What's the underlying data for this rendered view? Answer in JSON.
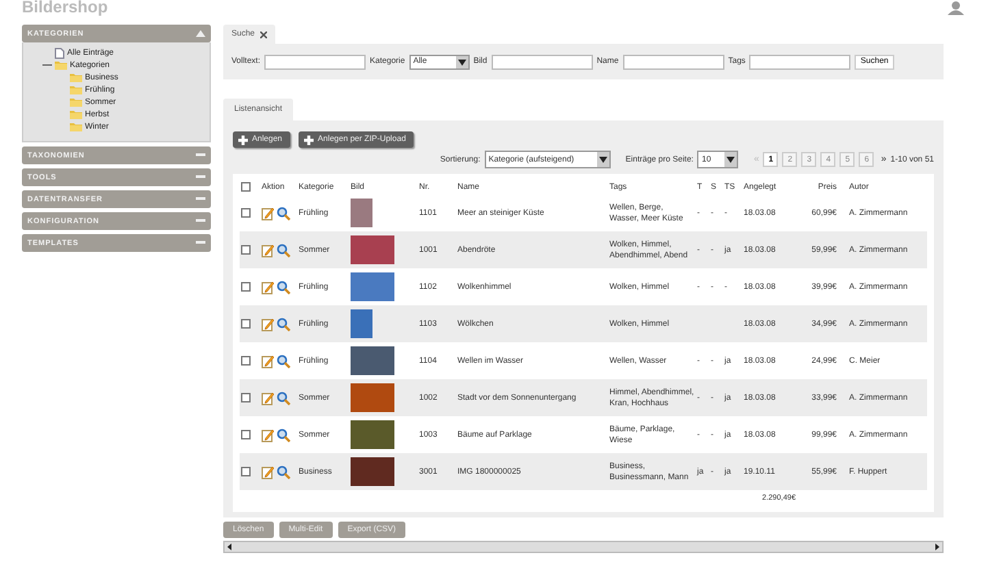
{
  "app": {
    "title": "Bildershop"
  },
  "sidebar": {
    "sections": [
      {
        "title": "KATEGORIEN",
        "expanded": true,
        "tree": [
          {
            "label": "Alle Einträge",
            "kind": "page"
          },
          {
            "label": "Kategorien",
            "kind": "folder",
            "expanded": true,
            "children": [
              {
                "label": "Business",
                "kind": "folder"
              },
              {
                "label": "Frühling",
                "kind": "folder"
              },
              {
                "label": "Sommer",
                "kind": "folder"
              },
              {
                "label": "Herbst",
                "kind": "folder"
              },
              {
                "label": "Winter",
                "kind": "folder"
              }
            ]
          }
        ]
      },
      {
        "title": "TAXONOMIEN",
        "expanded": false
      },
      {
        "title": "TOOLS",
        "expanded": false
      },
      {
        "title": "DATENTRANSFER",
        "expanded": false
      },
      {
        "title": "KONFIGURATION",
        "expanded": false
      },
      {
        "title": "TEMPLATES",
        "expanded": false
      }
    ]
  },
  "search": {
    "tab": "Suche",
    "fields": [
      {
        "label": "Volltext:",
        "kind": "text"
      },
      {
        "label": "Kategorie",
        "kind": "select",
        "value": "Alle"
      },
      {
        "label": "Bild",
        "kind": "text"
      },
      {
        "label": "Name",
        "kind": "text"
      },
      {
        "label": "Tags",
        "kind": "text"
      }
    ],
    "button": "Suchen"
  },
  "list": {
    "tab": "Listenansicht",
    "actions": [
      "Anlegen",
      "Anlegen per ZIP-Upload"
    ],
    "sort": {
      "label": "Sortierung:",
      "value": "Kategorie (aufsteigend)"
    },
    "per_page": {
      "label": "Einträge pro Seite:",
      "value": "10"
    },
    "pagination": {
      "prev": "«",
      "pages": [
        {
          "label": "1",
          "selected": true
        },
        {
          "label": "2",
          "selected": false
        },
        {
          "label": "3",
          "selected": false
        },
        {
          "label": "4",
          "selected": false
        },
        {
          "label": "5",
          "selected": false
        },
        {
          "label": "6",
          "selected": false
        }
      ],
      "next": "»",
      "range": "1-10 von 51"
    },
    "table": {
      "select_all_checked": false,
      "columns": [
        "Aktion",
        "Kategorie",
        "Bild",
        "Nr.",
        "Name",
        "Tags",
        "T",
        "S",
        "TS",
        "Angelegt",
        "Preis",
        "Autor"
      ],
      "rows": [
        {
          "checked": false,
          "category": "Frühling",
          "number": "1101",
          "name": "Meer an steiniger Küste",
          "tags": "Wellen, Berge, Wasser, Meer Küste",
          "t": "-",
          "s": "-",
          "ts": "-",
          "created": "18.03.08",
          "price": "60,99€",
          "author": "A. Zimmermann"
        },
        {
          "checked": false,
          "category": "Sommer",
          "number": "1001",
          "name": "Abendröte",
          "tags": "Wolken, Himmel, Abendhimmel, Abend",
          "t": "-",
          "s": "-",
          "ts": "ja",
          "created": "18.03.08",
          "price": "59,99€",
          "author": "A. Zimmermann"
        },
        {
          "checked": false,
          "category": "Frühling",
          "number": "1102",
          "name": "Wolkenhimmel",
          "tags": "Wolken, Himmel",
          "t": "-",
          "s": "-",
          "ts": "-",
          "created": "18.03.08",
          "price": "39,99€",
          "author": "A. Zimmermann"
        },
        {
          "checked": false,
          "category": "Frühling",
          "number": "1103",
          "name": "Wölkchen",
          "tags": "Wolken, Himmel",
          "created": "18.03.08",
          "price": "34,99€",
          "author": "A. Zimmermann"
        },
        {
          "checked": false,
          "category": "Frühling",
          "number": "1104",
          "name": "Wellen im Wasser",
          "tags": "Wellen, Wasser",
          "t": "-",
          "s": "-",
          "ts": "ja",
          "created": "18.03.08",
          "price": "24,99€",
          "author": "C. Meier"
        },
        {
          "checked": false,
          "category": "Sommer",
          "number": "1002",
          "name": "Stadt vor dem Sonnenuntergang",
          "tags": "Himmel, Abendhimmel, Kran, Hochhaus",
          "t": "-",
          "s": "-",
          "ts": "ja",
          "created": "18.03.08",
          "price": "33,99€",
          "author": "A. Zimmermann"
        },
        {
          "checked": false,
          "category": "Sommer",
          "number": "1003",
          "name": "Bäume auf Parklage",
          "tags": "Bäume, Parklage, Wiese",
          "t": "-",
          "s": "-",
          "ts": "ja",
          "created": "18.03.08",
          "price": "99,99€",
          "author": "A. Zimmermann"
        },
        {
          "checked": false,
          "category": "Business",
          "number": "3001",
          "name": "IMG 1800000025",
          "tags": "Business, Businessmann, Mann",
          "t": "ja",
          "s": "-",
          "ts": "ja",
          "created": "19.10.11",
          "price": "55,99€",
          "author": "F. Huppert"
        }
      ],
      "total": "2.290,49€"
    },
    "footer_buttons": [
      "Löschen",
      "Multi-Edit",
      "Export (CSV)"
    ]
  }
}
